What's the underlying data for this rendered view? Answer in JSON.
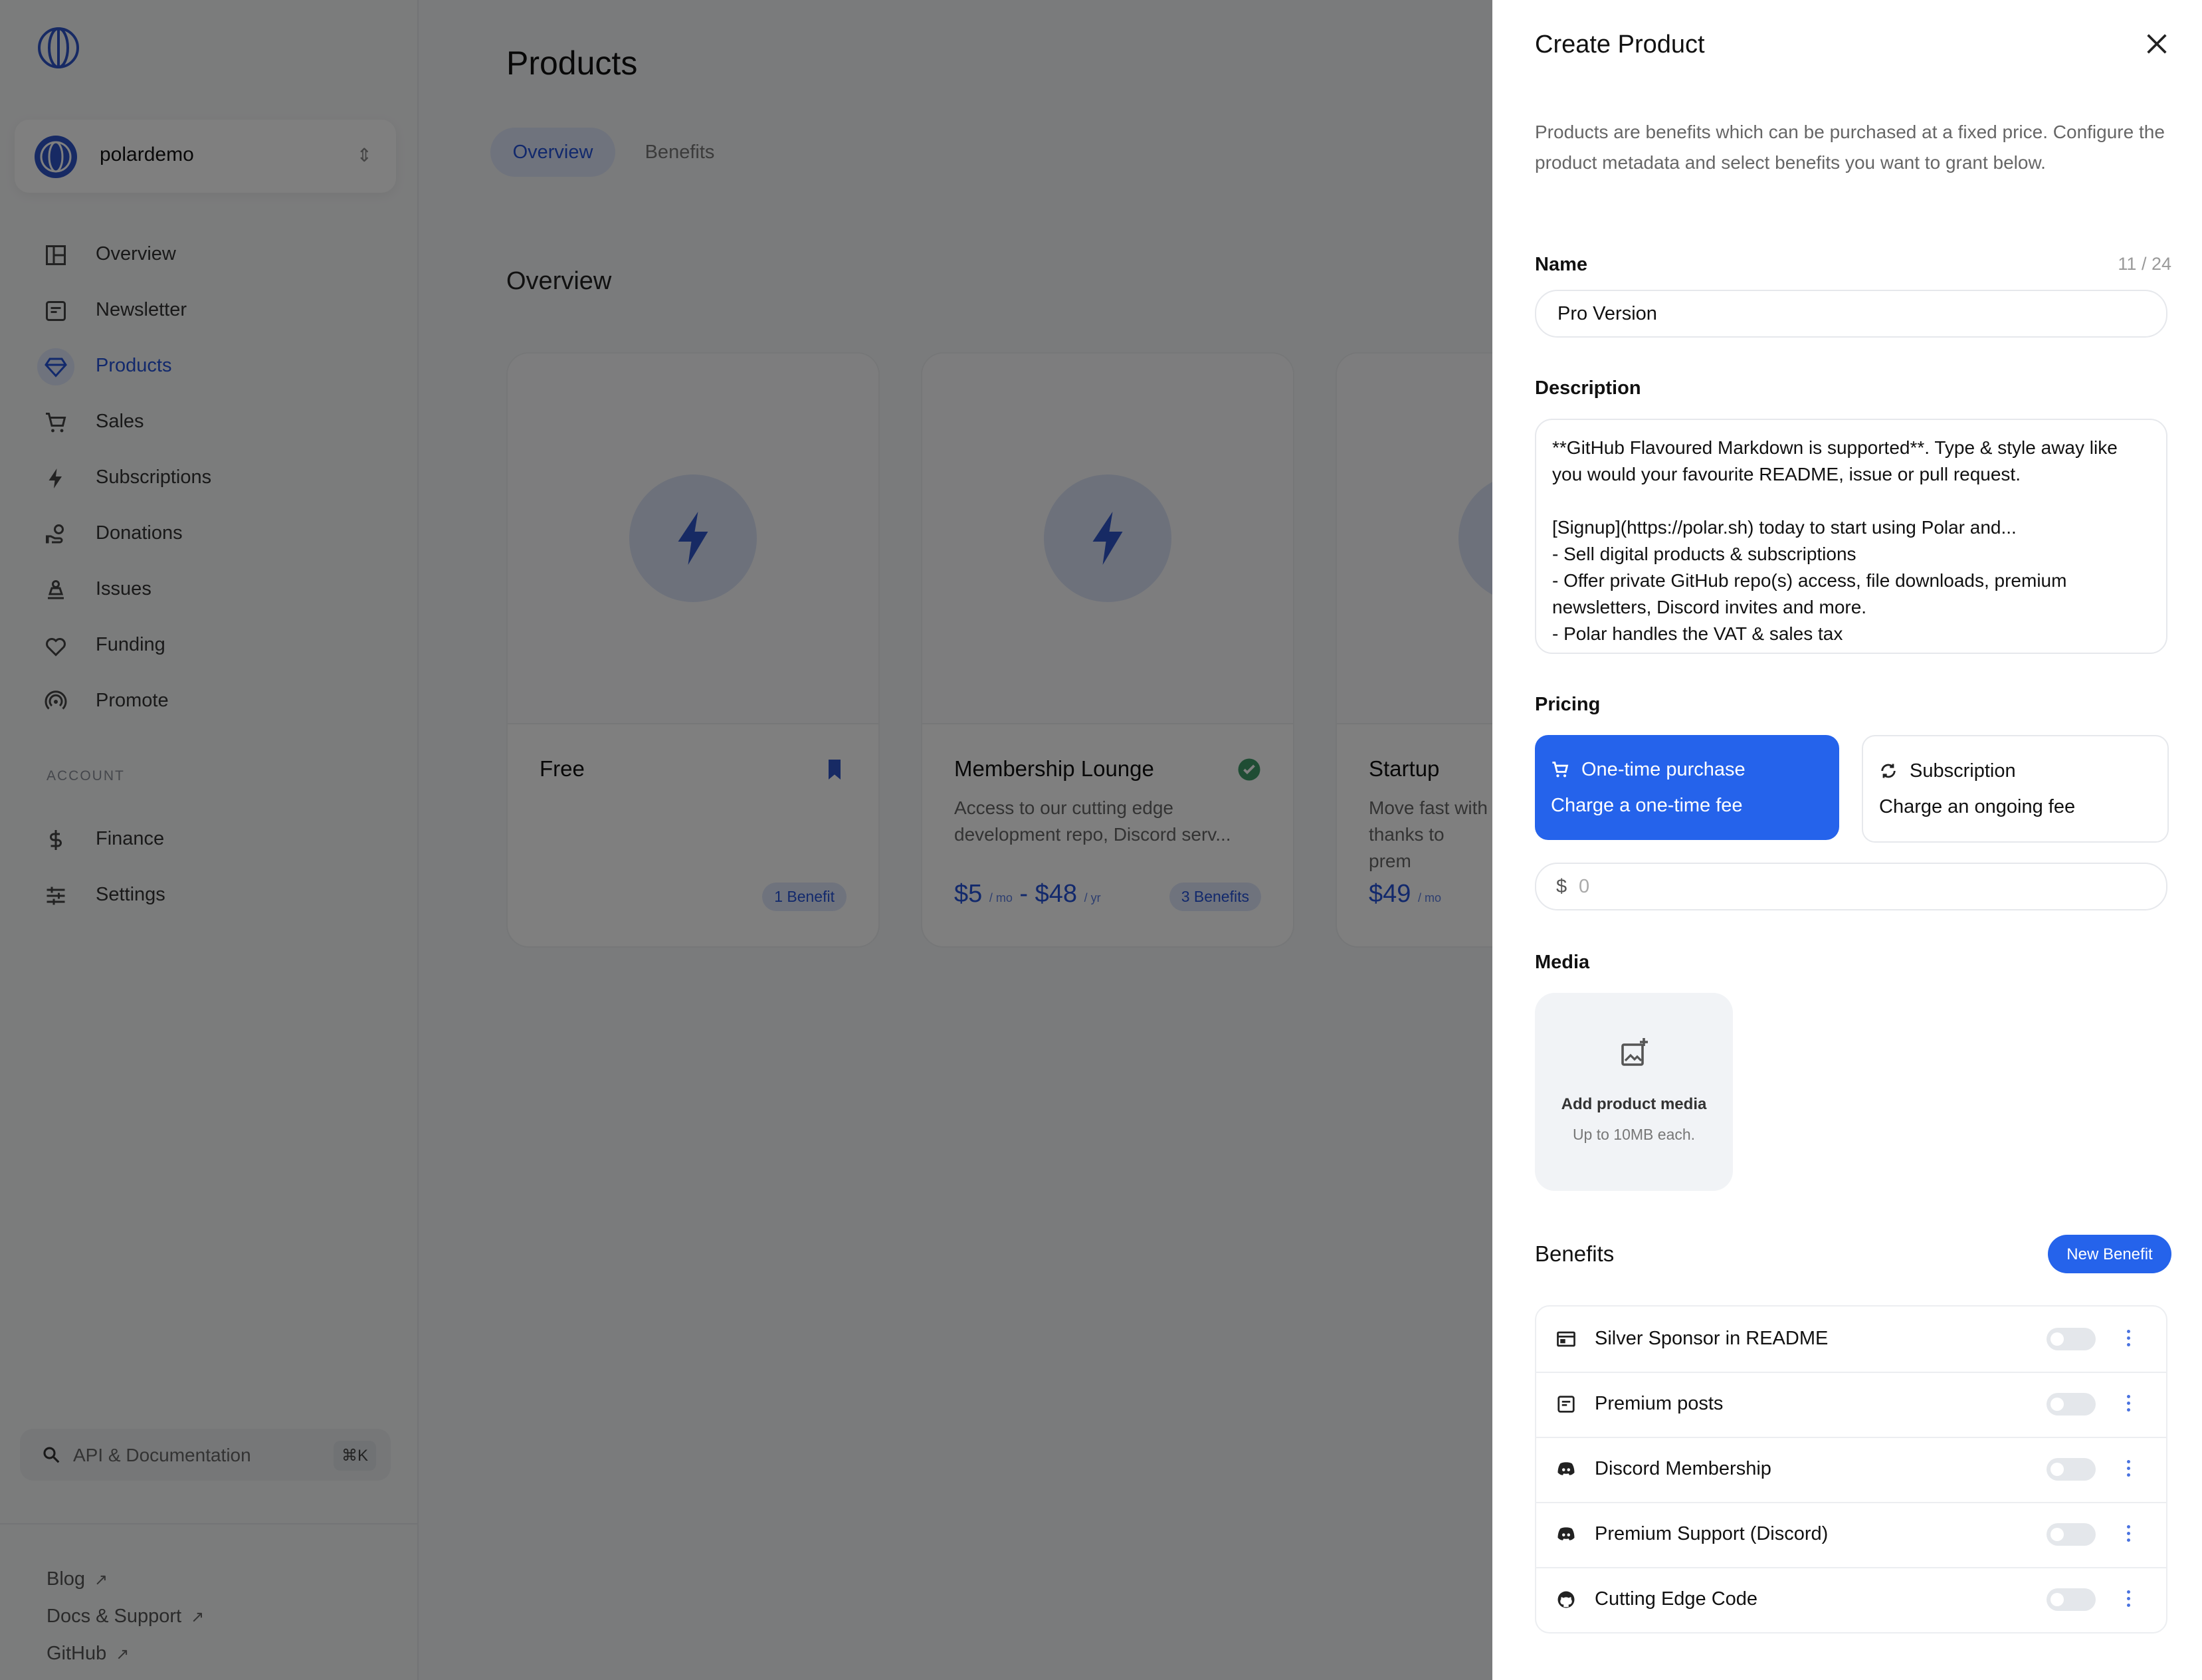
{
  "sidebar": {
    "org_name": "polardemo",
    "nav": [
      {
        "label": "Overview",
        "icon": "layout-icon"
      },
      {
        "label": "Newsletter",
        "icon": "newsletter-icon"
      },
      {
        "label": "Products",
        "icon": "diamond-icon"
      },
      {
        "label": "Sales",
        "icon": "cart-icon"
      },
      {
        "label": "Subscriptions",
        "icon": "bolt-icon"
      },
      {
        "label": "Donations",
        "icon": "hand-coin-icon"
      },
      {
        "label": "Issues",
        "icon": "issues-icon"
      },
      {
        "label": "Funding",
        "icon": "heart-icon"
      },
      {
        "label": "Promote",
        "icon": "broadcast-icon"
      }
    ],
    "account_heading": "ACCOUNT",
    "account_nav": [
      {
        "label": "Finance",
        "icon": "dollar-icon"
      },
      {
        "label": "Settings",
        "icon": "sliders-icon"
      }
    ],
    "search_label": "API & Documentation",
    "search_shortcut": "⌘K",
    "footer_links": [
      {
        "label": "Blog",
        "icon": "arrow-up-right-icon"
      },
      {
        "label": "Docs & Support",
        "icon": "arrow-up-right-icon"
      },
      {
        "label": "GitHub",
        "icon": "arrow-up-right-icon"
      }
    ]
  },
  "main": {
    "title": "Products",
    "tabs": [
      {
        "label": "Overview",
        "active": true
      },
      {
        "label": "Benefits",
        "active": false
      }
    ],
    "section_title": "Overview",
    "cards": [
      {
        "name": "Free",
        "desc": "",
        "price": "",
        "badge": "1 Benefit"
      },
      {
        "name": "Membership Lounge",
        "desc": "Access to our cutting edge development repo, Discord serv...",
        "price_a": "$5",
        "unit_a": "/ mo",
        "price_sep": "-",
        "price_b": "$48",
        "unit_b": "/ yr",
        "badge": "3 Benefits"
      },
      {
        "name": "Startup",
        "desc": "Move fast with thanks to prem",
        "price_a": "$49",
        "unit_a": "/ mo"
      }
    ]
  },
  "panel": {
    "title": "Create Product",
    "intro": "Products are benefits which can be purchased at a fixed price. Configure the product metadata and select benefits you want to grant below.",
    "name_label": "Name",
    "name_count": "11 / 24",
    "name_value": "Pro Version",
    "description_label": "Description",
    "description_value": "**GitHub Flavoured Markdown is supported**. Type & style away like you would your favourite README, issue or pull request.\n\n[Signup](https://polar.sh) today to start using Polar and...\n- Sell digital products & subscriptions\n- Offer private GitHub repo(s) access, file downloads, premium newsletters, Discord invites and more.\n- Polar handles the VAT & sales tax",
    "pricing_label": "Pricing",
    "pricing_options": [
      {
        "title": "One-time purchase",
        "subtitle": "Charge a one-time fee",
        "selected": true,
        "icon": "cart-icon"
      },
      {
        "title": "Subscription",
        "subtitle": "Charge an ongoing fee",
        "selected": false,
        "icon": "refresh-icon"
      }
    ],
    "price_currency": "$",
    "price_placeholder": "0",
    "media_label": "Media",
    "media_title": "Add product media",
    "media_subtitle": "Up to 10MB each.",
    "benefits_label": "Benefits",
    "new_benefit_label": "New Benefit",
    "benefits": [
      {
        "label": "Silver Sponsor in README",
        "icon": "sponsor-icon",
        "enabled": false
      },
      {
        "label": "Premium posts",
        "icon": "newsletter-icon",
        "enabled": false
      },
      {
        "label": "Discord Membership",
        "icon": "discord-icon",
        "enabled": false
      },
      {
        "label": "Premium Support (Discord)",
        "icon": "discord-icon",
        "enabled": false
      },
      {
        "label": "Cutting Edge Code",
        "icon": "github-icon",
        "enabled": false
      }
    ]
  },
  "colors": {
    "accent": "#2563eb",
    "accent_text": "#2552d8",
    "accent_soft": "#dfe7fb",
    "overlay": "rgba(0,0,0,0.5)"
  }
}
